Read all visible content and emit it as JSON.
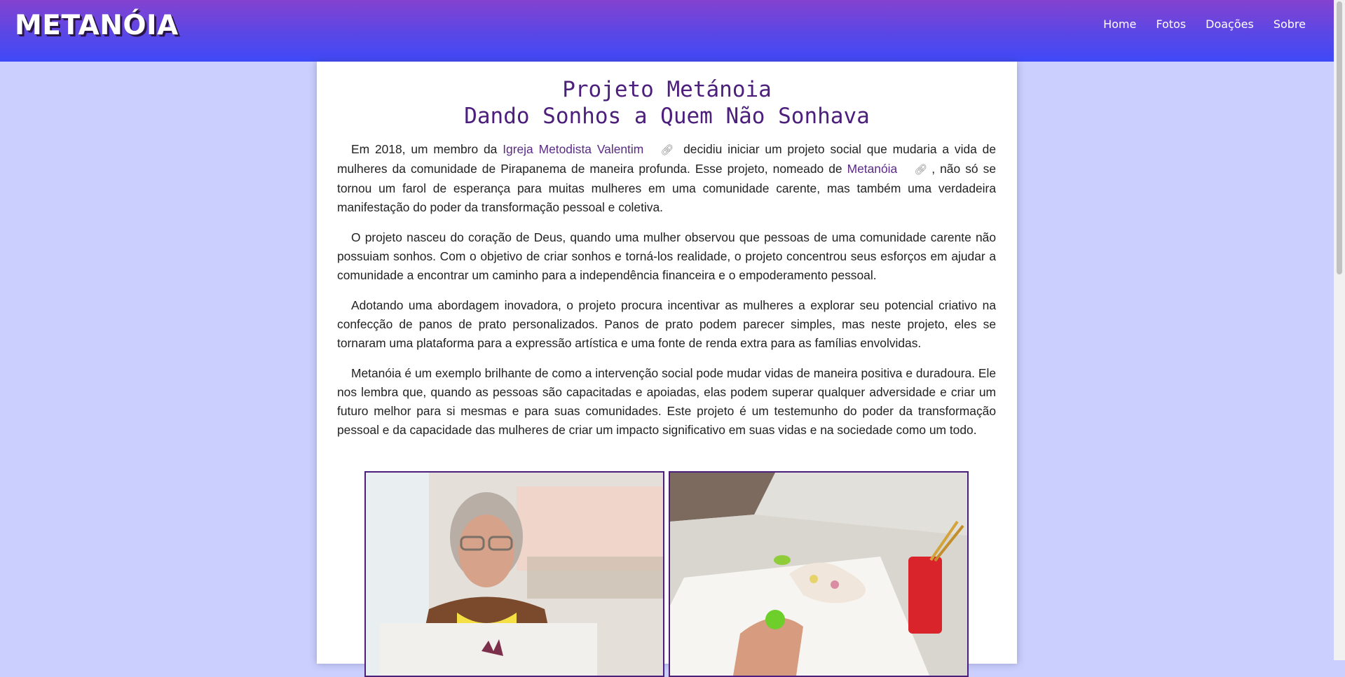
{
  "header": {
    "logo": "METANÓIA",
    "nav": [
      "Home",
      "Fotos",
      "Doações",
      "Sobre"
    ]
  },
  "article": {
    "title_line1": "Projeto Metánoia",
    "title_line2": "Dando Sonhos a Quem Não Sonhava",
    "p1_a": "Em 2018, um membro da ",
    "p1_link1": "Igreja Metodista Valentim",
    "p1_b": " decidiu iniciar um projeto social que mudaria a vida de mulheres da comunidade de Pirapanema de maneira profunda. Esse projeto, nomeado de ",
    "p1_link2": "Metanóia",
    "p1_c": ", não só se tornou um farol de esperança para muitas mulheres em uma comunidade carente, mas também uma verdadeira manifestação do poder da transformação pessoal e coletiva.",
    "p2": "O projeto nasceu do coração de Deus, quando uma mulher observou que pessoas de uma comunidade carente não possuiam sonhos. Com o objetivo de criar sonhos e torná-los realidade, o projeto concentrou seus esforços em ajudar a comunidade a encontrar um caminho para a independência financeira e o empoderamento pessoal.",
    "p3": "Adotando uma abordagem inovadora, o projeto procura incentivar as mulheres a explorar seu potencial criativo na confecção de panos de prato personalizados. Panos de prato podem parecer simples, mas neste projeto, eles se tornaram uma plataforma para a expressão artística e uma fonte de renda extra para as famílias envolvidas.",
    "p4": "Metanóia é um exemplo brilhante de como a intervenção social pode mudar vidas de maneira positiva e duradoura. Ele nos lembra que, quando as pessoas são capacitadas e apoiadas, elas podem superar qualquer adversidade e criar um futuro melhor para si mesmas e para suas comunidades. Este projeto é um testemunho do poder da transformação pessoal e da capacidade das mulheres de criar um impacto significativo em suas vidas e na sociedade como um todo."
  },
  "icons": {
    "link": "link-icon"
  },
  "colors": {
    "accent": "#4d1f7c",
    "page_background": "#cbcffd",
    "header_gradient_top": "#8442cf",
    "header_gradient_bottom": "#3f49f8"
  }
}
